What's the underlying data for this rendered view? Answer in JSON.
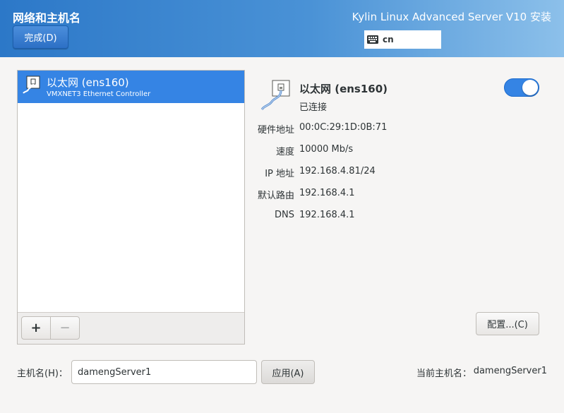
{
  "header": {
    "page_title": "网络和主机名",
    "done_label": "完成(D)",
    "product_title": "Kylin Linux Advanced Server V10 安装",
    "keyboard_layout": "cn",
    "gradient_colors": [
      "#2c78c8",
      "#8cc0ea"
    ]
  },
  "devices": [
    {
      "name": "以太网 (ens160)",
      "description": "VMXNET3 Ethernet Controller",
      "selected": true,
      "icon": "network-wired-icon"
    }
  ],
  "device_toolbar": {
    "add_label": "+",
    "remove_label": "−"
  },
  "detail": {
    "name": "以太网 (ens160)",
    "status": "已连接",
    "enabled": true,
    "accent_color": "#3584e4",
    "rows": [
      {
        "label": "硬件地址",
        "value": "00:0C:29:1D:0B:71"
      },
      {
        "label": "速度",
        "value": "10000 Mb/s"
      },
      {
        "label": "IP 地址",
        "value": "192.168.4.81/24"
      },
      {
        "label": "默认路由",
        "value": "192.168.4.1"
      },
      {
        "label": "DNS",
        "value": "192.168.4.1"
      }
    ],
    "config_label": "配置...(C)"
  },
  "hostname": {
    "label": "主机名(H)：",
    "value": "damengServer1",
    "apply_label": "应用(A)",
    "current_label": "当前主机名：",
    "current_value": "damengServer1"
  }
}
